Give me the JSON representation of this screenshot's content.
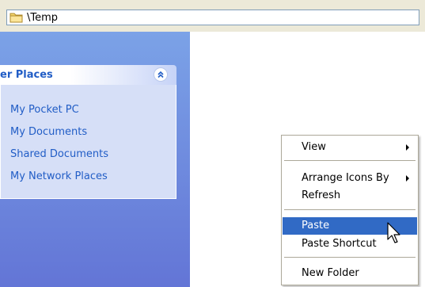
{
  "address_bar": {
    "path": "\\Temp",
    "icon": "folder-icon"
  },
  "left_pane": {
    "panel": {
      "title": "er Places",
      "collapse_icon": "chevron-double-up-icon",
      "links": [
        {
          "label": "My Pocket PC"
        },
        {
          "label": "My Documents"
        },
        {
          "label": "Shared Documents"
        },
        {
          "label": "My Network Places"
        }
      ]
    }
  },
  "context_menu": {
    "items": [
      {
        "label": "View",
        "submenu": true
      },
      {
        "label": "Arrange Icons By",
        "submenu": true
      },
      {
        "label": "Refresh",
        "submenu": false
      },
      {
        "label": "Paste",
        "submenu": false,
        "selected": true
      },
      {
        "label": "Paste Shortcut",
        "submenu": false
      },
      {
        "label": "New Folder",
        "submenu": false
      }
    ]
  },
  "colors": {
    "selection": "#316ac5",
    "link": "#215dc6",
    "pane_top": "#7ba2e7",
    "pane_bottom": "#6375d6"
  }
}
